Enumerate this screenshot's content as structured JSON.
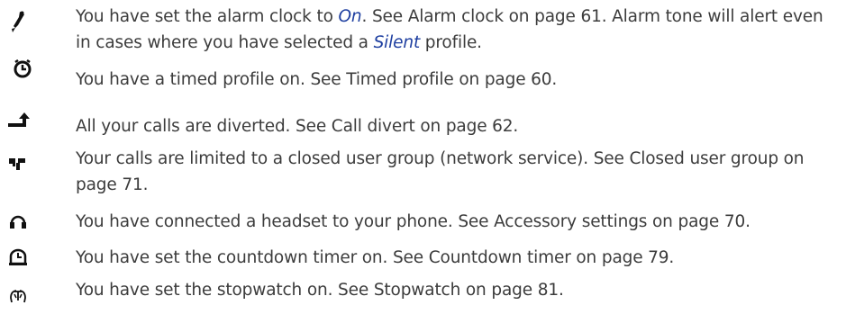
{
  "entries": [
    {
      "icon": "alarm-clock-icon",
      "before": "You have set the alarm clock to ",
      "em1": "On",
      "mid": ". See Alarm clock on page 61. Alarm tone will alert even in cases where you have selected a ",
      "em2": "Silent",
      "after": " profile."
    },
    {
      "icon": "timed-profile-icon",
      "text": "You have a timed profile on. See Timed profile on page 60."
    },
    {
      "icon": "call-divert-icon",
      "text": "All your calls are diverted. See Call divert on page 62."
    },
    {
      "icon": "closed-user-group-icon",
      "text": "Your calls are limited to a closed user group (network service). See Closed user group on page 71."
    },
    {
      "icon": "headset-icon",
      "text": "You have connected a headset to your phone. See Accessory settings on page 70."
    },
    {
      "icon": "countdown-timer-icon",
      "text": "You have set the countdown timer on. See Countdown timer on page 79."
    },
    {
      "icon": "stopwatch-icon",
      "text": "You have set the stopwatch on. See Stopwatch on page 81."
    }
  ],
  "colors": {
    "text": "#3c3c3c",
    "emphasis": "#1e3fa0",
    "icon": "#111111"
  }
}
